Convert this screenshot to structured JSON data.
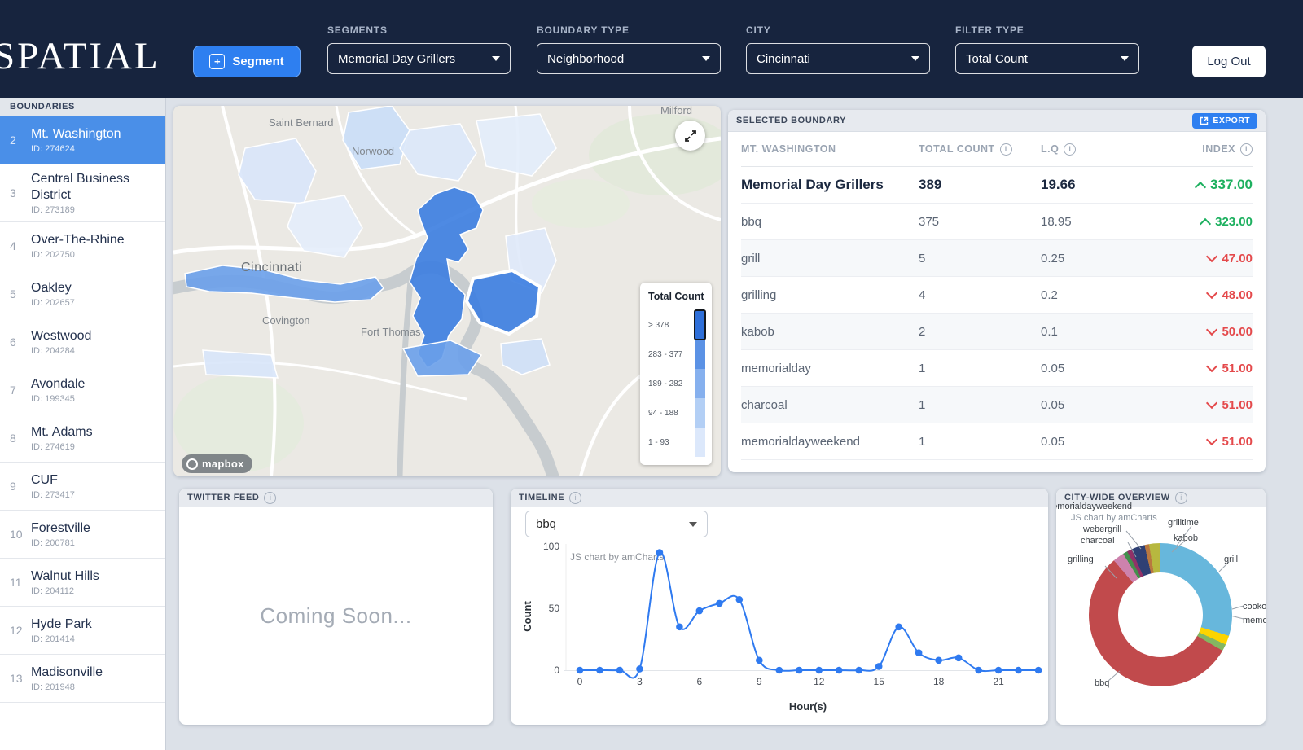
{
  "header": {
    "logo": "SPATIAL",
    "segment_plus": "+",
    "segment_button": "Segment",
    "logout": "Log Out",
    "controls": [
      {
        "label": "SEGMENTS",
        "value": "Memorial Day Grillers"
      },
      {
        "label": "BOUNDARY TYPE",
        "value": "Neighborhood"
      },
      {
        "label": "CITY",
        "value": "Cincinnati"
      },
      {
        "label": "FILTER TYPE",
        "value": "Total Count"
      }
    ]
  },
  "sidebar": {
    "title": "BOUNDARIES",
    "items": [
      {
        "rank": 2,
        "name": "Mt. Washington",
        "id": "ID: 274624",
        "selected": true
      },
      {
        "rank": 3,
        "name": "Central Business District",
        "id": "ID: 273189"
      },
      {
        "rank": 4,
        "name": "Over-The-Rhine",
        "id": "ID: 202750"
      },
      {
        "rank": 5,
        "name": "Oakley",
        "id": "ID: 202657"
      },
      {
        "rank": 6,
        "name": "Westwood",
        "id": "ID: 204284"
      },
      {
        "rank": 7,
        "name": "Avondale",
        "id": "ID: 199345"
      },
      {
        "rank": 8,
        "name": "Mt. Adams",
        "id": "ID: 274619"
      },
      {
        "rank": 9,
        "name": "CUF",
        "id": "ID: 273417"
      },
      {
        "rank": 10,
        "name": "Forestville",
        "id": "ID: 200781"
      },
      {
        "rank": 11,
        "name": "Walnut Hills",
        "id": "ID: 204112"
      },
      {
        "rank": 12,
        "name": "Hyde Park",
        "id": "ID: 201414"
      },
      {
        "rank": 13,
        "name": "Madisonville",
        "id": "ID: 201948"
      }
    ]
  },
  "map": {
    "labels": [
      "Saint Bernard",
      "Norwood",
      "Milford",
      "Cincinnati",
      "Covington",
      "Fort Thomas"
    ],
    "legend": {
      "title": "Total Count",
      "entries": [
        {
          "label": "> 378",
          "color": "#2e6fd9",
          "selected": true
        },
        {
          "label": "283 - 377",
          "color": "#5b92e5"
        },
        {
          "label": "189 - 282",
          "color": "#86b0ee"
        },
        {
          "label": "94 - 188",
          "color": "#b3cff5"
        },
        {
          "label": "1 - 93",
          "color": "#dce8fb"
        }
      ]
    },
    "attribution": "mapbox"
  },
  "selected_boundary": {
    "panel_title": "SELECTED BOUNDARY",
    "export_label": "EXPORT",
    "columns": [
      "MT. WASHINGTON",
      "TOTAL COUNT",
      "L.Q",
      "INDEX"
    ],
    "rows": [
      {
        "term": "Memorial Day Grillers",
        "total": "389",
        "lq": "19.66",
        "index": "337.00",
        "dir": "up"
      },
      {
        "term": "bbq",
        "total": "375",
        "lq": "18.95",
        "index": "323.00",
        "dir": "up"
      },
      {
        "term": "grill",
        "total": "5",
        "lq": "0.25",
        "index": "47.00",
        "dir": "down"
      },
      {
        "term": "grilling",
        "total": "4",
        "lq": "0.2",
        "index": "48.00",
        "dir": "down"
      },
      {
        "term": "kabob",
        "total": "2",
        "lq": "0.1",
        "index": "50.00",
        "dir": "down"
      },
      {
        "term": "memorialday",
        "total": "1",
        "lq": "0.05",
        "index": "51.00",
        "dir": "down"
      },
      {
        "term": "charcoal",
        "total": "1",
        "lq": "0.05",
        "index": "51.00",
        "dir": "down"
      },
      {
        "term": "memorialdayweekend",
        "total": "1",
        "lq": "0.05",
        "index": "51.00",
        "dir": "down"
      }
    ]
  },
  "twitter": {
    "panel_title": "TWITTER FEED",
    "message": "Coming Soon..."
  },
  "chart_data": [
    {
      "type": "line",
      "title": "TIMELINE",
      "series_selector": "bbq",
      "values": [
        0,
        0,
        0,
        1,
        95,
        35,
        48,
        54,
        57,
        8,
        0,
        0,
        0,
        0,
        0,
        3,
        35,
        14,
        8,
        10,
        0,
        0,
        0,
        0
      ],
      "xlabel": "Hour(s)",
      "ylabel": "Count",
      "ylim": [
        0,
        100
      ],
      "yticks": [
        0,
        50,
        100
      ],
      "xticks": [
        0,
        3,
        6,
        9,
        12,
        15,
        18,
        21
      ],
      "watermark": "JS chart by amCharts",
      "line_color": "#2f7af0"
    },
    {
      "type": "pie",
      "title": "CITY-WIDE OVERVIEW",
      "watermark": "JS chart by amCharts",
      "slices": [
        {
          "label": "grill",
          "value": 29,
          "color": "#67b7dc"
        },
        {
          "label": "cookout",
          "value": 2,
          "color": "#fdd400"
        },
        {
          "label": "memorialday",
          "value": 1.5,
          "color": "#84b761"
        },
        {
          "label": "bbq",
          "value": 54,
          "color": "#c14a4c"
        },
        {
          "label": "grilling",
          "value": 2.5,
          "color": "#cd82ad"
        },
        {
          "label": "webergrill",
          "value": 1,
          "color": "#448e4d"
        },
        {
          "label": "memorialdayweekend",
          "value": 1,
          "color": "#913167"
        },
        {
          "label": "charcoal",
          "value": 3,
          "color": "#2f4074"
        },
        {
          "label": "grilltime",
          "value": 1,
          "color": "#b9783f"
        },
        {
          "label": "kabob",
          "value": 2.5,
          "color": "#b7b83f"
        }
      ]
    }
  ]
}
